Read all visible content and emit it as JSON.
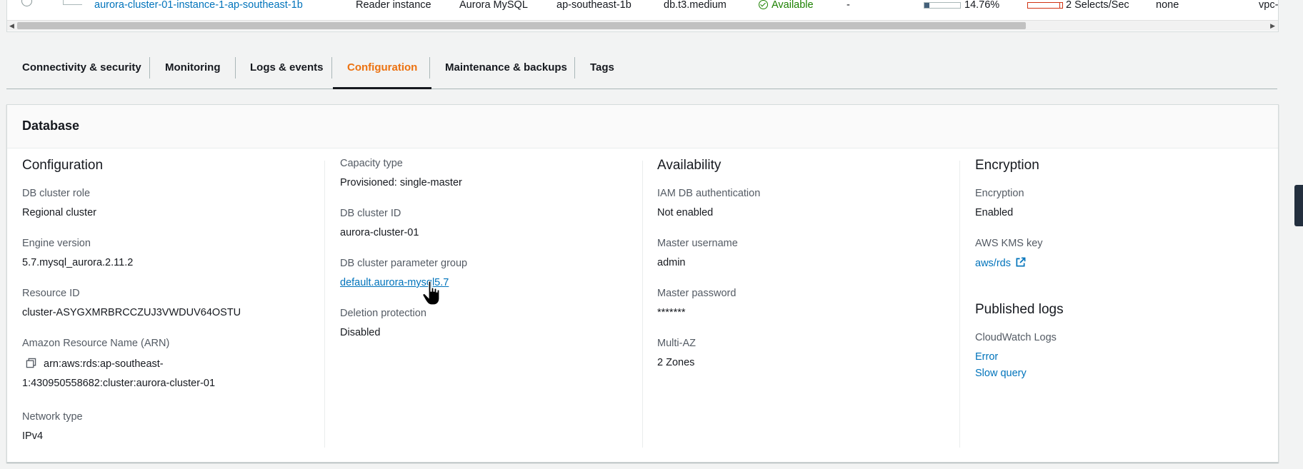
{
  "table_row": {
    "instance_name": "aurora-cluster-01-instance-1-ap-southeast-1b",
    "role": "Reader instance",
    "engine": "Aurora MySQL",
    "region_az": "ap-southeast-1b",
    "size": "db.t3.medium",
    "status": "Available",
    "dash": "-",
    "cpu": "14.76%",
    "cpu_fraction": 0.1476,
    "activity": "2 Selects/Sec",
    "maintenance": "none",
    "vpc": "vpc-"
  },
  "tabs": [
    {
      "label": "Connectivity & security",
      "active": false
    },
    {
      "label": "Monitoring",
      "active": false
    },
    {
      "label": "Logs & events",
      "active": false
    },
    {
      "label": "Configuration",
      "active": true
    },
    {
      "label": "Maintenance & backups",
      "active": false
    },
    {
      "label": "Tags",
      "active": false
    }
  ],
  "panel": {
    "title": "Database",
    "configuration": {
      "title": "Configuration",
      "db_cluster_role_label": "DB cluster role",
      "db_cluster_role": "Regional cluster",
      "engine_version_label": "Engine version",
      "engine_version": "5.7.mysql_aurora.2.11.2",
      "resource_id_label": "Resource ID",
      "resource_id": "cluster-ASYGXMRBRCCZUJ3VWDUV64OSTU",
      "arn_label": "Amazon Resource Name (ARN)",
      "arn_line1": "arn:aws:rds:ap-southeast-",
      "arn_line2": "1:430950558682:cluster:aurora-cluster-01",
      "network_type_label": "Network type",
      "network_type": "IPv4"
    },
    "capacity": {
      "capacity_type_label": "Capacity type",
      "capacity_type": "Provisioned: single-master",
      "cluster_id_label": "DB cluster ID",
      "cluster_id": "aurora-cluster-01",
      "param_group_label": "DB cluster parameter group",
      "param_group": "default.aurora-mysql5.7",
      "deletion_protection_label": "Deletion protection",
      "deletion_protection": "Disabled"
    },
    "availability": {
      "title": "Availability",
      "iam_auth_label": "IAM DB authentication",
      "iam_auth": "Not enabled",
      "master_username_label": "Master username",
      "master_username": "admin",
      "master_password_label": "Master password",
      "master_password": "*******",
      "multi_az_label": "Multi-AZ",
      "multi_az": "2 Zones"
    },
    "encryption": {
      "title": "Encryption",
      "encryption_label": "Encryption",
      "encryption": "Enabled",
      "kms_key_label": "AWS KMS key",
      "kms_key": "aws/rds",
      "published_logs_title": "Published logs",
      "cloudwatch_label": "CloudWatch Logs",
      "log_error": "Error",
      "log_slow_query": "Slow query"
    }
  },
  "colors": {
    "link": "#0073bb",
    "active_tab": "#ec7211",
    "available": "#1d8102"
  }
}
